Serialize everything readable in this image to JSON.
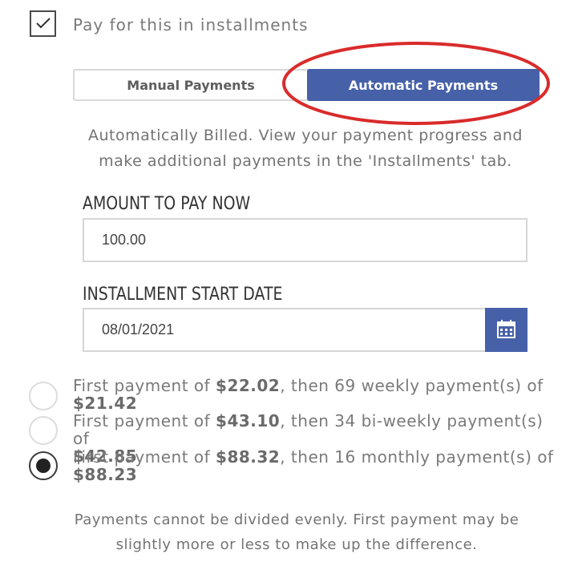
{
  "installments": {
    "checkbox_checked": true,
    "checkbox_label": "Pay for this in installments"
  },
  "mode_toggle": {
    "manual_label": "Manual Payments",
    "automatic_label": "Automatic Payments",
    "selected": "Automatic Payments",
    "accent_color": "#4761a9"
  },
  "annotation": {
    "shape": "ellipse",
    "color": "#d92b2b",
    "target": "Automatic Payments"
  },
  "description": {
    "line1": "Automatically Billed. View your payment progress and",
    "line2": "make additional payments in the 'Installments' tab."
  },
  "amount": {
    "label": "AMOUNT TO PAY NOW",
    "value": "100.00"
  },
  "start_date": {
    "label": "INSTALLMENT START DATE",
    "value": "08/01/2021",
    "icon": "calendar-icon"
  },
  "plans": [
    {
      "prefix": "First payment of ",
      "first": "$22.02",
      "middle": ", then 69 weekly payment(s) of",
      "recurring": "$21.42",
      "selected": false
    },
    {
      "prefix": "First payment of ",
      "first": "$43.10",
      "middle": ", then 34 bi-weekly payment(s) of",
      "recurring": "$42.85",
      "selected": false
    },
    {
      "prefix": "First payment of ",
      "first": "$88.32",
      "middle": ", then 16 monthly payment(s) of",
      "recurring": "$88.23",
      "selected": true
    }
  ],
  "footnote": {
    "line1": "Payments cannot be divided evenly. First payment may be",
    "line2": "slightly more or less to make up the difference."
  }
}
